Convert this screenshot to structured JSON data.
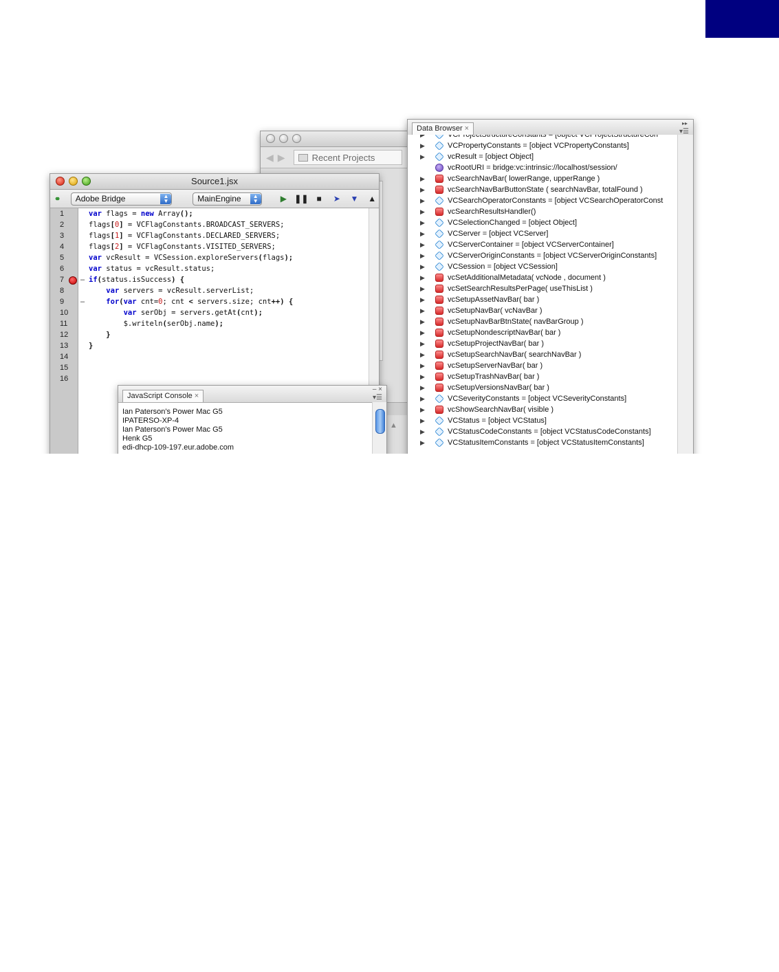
{
  "bridge": {
    "search_label": "Recent Projects"
  },
  "source": {
    "title": "Source1.jsx",
    "target_app": "Adobe Bridge",
    "engine": "MainEngine",
    "line_numbers": [
      "1",
      "2",
      "3",
      "4",
      "5",
      "6",
      "7",
      "8",
      "9",
      "10",
      "11",
      "12",
      "13",
      "14",
      "15",
      "16"
    ],
    "breakpoint_line": 7
  },
  "console": {
    "tab_label": "JavaScript Console",
    "lines": [
      "Ian Paterson's Power Mac G5",
      "IPATERSO-XP-4",
      "Ian Paterson's Power Mac G5",
      "Henk G5",
      "edi-dhcp-109-197.eur.adobe.com"
    ]
  },
  "data_browser": {
    "tab_label": "Data Browser",
    "rows": [
      {
        "icon": "object-icon",
        "text": "VCProjectStructureConstants = [object VCProjectStructureCon"
      },
      {
        "icon": "object-icon",
        "text": "VCPropertyConstants = [object VCPropertyConstants]"
      },
      {
        "icon": "object-icon",
        "text": "vcResult = [object Object]"
      },
      {
        "icon": "string-icon",
        "text": "vcRootURI = bridge:vc:intrinsic://localhost/session/"
      },
      {
        "icon": "function-icon",
        "text": "vcSearchNavBar( lowerRange, upperRange )"
      },
      {
        "icon": "function-icon",
        "text": "vcSearchNavBarButtonState ( searchNavBar, totalFound )"
      },
      {
        "icon": "object-icon",
        "text": "VCSearchOperatorConstants = [object VCSearchOperatorConst"
      },
      {
        "icon": "function-icon",
        "text": "vcSearchResultsHandler()"
      },
      {
        "icon": "object-icon",
        "text": "VCSelectionChanged = [object Object]"
      },
      {
        "icon": "object-icon",
        "text": "VCServer = [object VCServer]"
      },
      {
        "icon": "object-icon",
        "text": "VCServerContainer = [object VCServerContainer]"
      },
      {
        "icon": "object-icon",
        "text": "VCServerOriginConstants = [object VCServerOriginConstants]"
      },
      {
        "icon": "object-icon",
        "text": "VCSession = [object VCSession]"
      },
      {
        "icon": "function-icon",
        "text": "vcSetAdditionalMetadata( vcNode , document )"
      },
      {
        "icon": "function-icon",
        "text": "vcSetSearchResultsPerPage( useThisList )"
      },
      {
        "icon": "function-icon",
        "text": "vcSetupAssetNavBar( bar )"
      },
      {
        "icon": "function-icon",
        "text": "vcSetupNavBar( vcNavBar )"
      },
      {
        "icon": "function-icon",
        "text": "vcSetupNavBarBtnState( navBarGroup )"
      },
      {
        "icon": "function-icon",
        "text": "vcSetupNondescriptNavBar( bar )"
      },
      {
        "icon": "function-icon",
        "text": "vcSetupProjectNavBar( bar )"
      },
      {
        "icon": "function-icon",
        "text": "vcSetupSearchNavBar( searchNavBar )"
      },
      {
        "icon": "function-icon",
        "text": "vcSetupServerNavBar( bar )"
      },
      {
        "icon": "function-icon",
        "text": "vcSetupTrashNavBar( bar )"
      },
      {
        "icon": "function-icon",
        "text": "vcSetupVersionsNavBar( bar )"
      },
      {
        "icon": "object-icon",
        "text": "VCSeverityConstants = [object VCSeverityConstants]"
      },
      {
        "icon": "function-icon",
        "text": "vcShowSearchNavBar( visible )"
      },
      {
        "icon": "object-icon",
        "text": "VCStatus = [object VCStatus]"
      },
      {
        "icon": "object-icon",
        "text": "VCStatusCodeConstants = [object VCStatusCodeConstants]"
      },
      {
        "icon": "object-icon",
        "text": "VCStatusItemConstants = [object VCStatusItemConstants]"
      }
    ]
  },
  "colors": {
    "corner_block": "#000080",
    "keyword": "#0000cc",
    "number": "#c81a1a",
    "breakpoint": "#c40000"
  }
}
